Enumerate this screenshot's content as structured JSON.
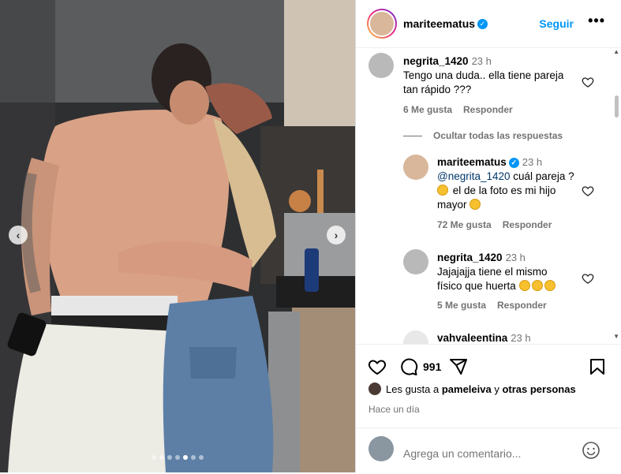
{
  "post": {
    "author": "mariteematus",
    "follow_label": "Seguir",
    "more_label": "•••",
    "carousel": {
      "prev": "‹",
      "next": "›",
      "dot_count": 7,
      "active_dot": 4
    }
  },
  "comments": [
    {
      "username": "negrita_1420",
      "time": "23 h",
      "text_line1": "Tengo una duda.. ella tiene pareja",
      "text_line2": "tan rápido ???",
      "likes": "6 Me gusta",
      "reply_label": "Responder"
    }
  ],
  "hide_replies_label": "Ocultar todas las respuestas",
  "replies": [
    {
      "username": "mariteematus",
      "time": "23 h",
      "mention": "@negrita_1420",
      "text_after_mention": " cuál pareja ?",
      "text_line2": " el de la foto es mi hijo",
      "text_line3": "mayor",
      "likes": "72 Me gusta",
      "reply_label": "Responder"
    },
    {
      "username": "negrita_1420",
      "time": "23 h",
      "text_line1": "Jajajajja tiene el mismo",
      "text_line2": "físico que huerta",
      "likes": "5 Me gusta",
      "reply_label": "Responder"
    },
    {
      "username": "vahvaleentina",
      "time": "23 h"
    }
  ],
  "footer": {
    "comment_count": "991",
    "likes_prefix": "Les gusta a ",
    "liker": "pameleiva",
    "likes_mid": " y ",
    "likes_others": "otras personas",
    "time_ago": "Hace un día",
    "comment_placeholder": "Agrega un comentario..."
  },
  "colors": {
    "accent": "#0095f6",
    "muted": "#737373",
    "mention": "#00376b"
  }
}
